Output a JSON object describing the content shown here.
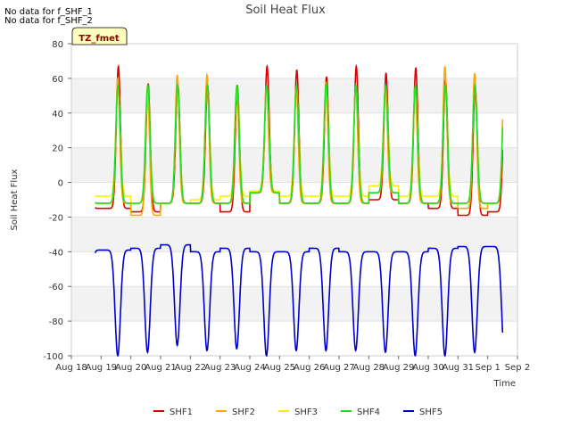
{
  "notes": [
    "No data for f_SHF_1",
    "No data for f_SHF_2"
  ],
  "chart_data": {
    "type": "line",
    "title": "Soil Heat Flux",
    "xlabel": "Time",
    "ylabel": "Soil Heat Flux",
    "annotation": "TZ_fmet",
    "xlim": [
      "Aug 18",
      "Sep 2"
    ],
    "ylim": [
      -100,
      80
    ],
    "x_ticks": [
      "Aug 18",
      "Aug 19",
      "Aug 20",
      "Aug 21",
      "Aug 22",
      "Aug 23",
      "Aug 24",
      "Aug 25",
      "Aug 26",
      "Aug 27",
      "Aug 28",
      "Aug 29",
      "Aug 30",
      "Aug 31",
      "Sep 1",
      "Sep 2"
    ],
    "y_ticks": [
      -100,
      -80,
      -60,
      -40,
      -20,
      0,
      20,
      40,
      60,
      80
    ],
    "grid": "horizontal bands",
    "legend_position": "bottom",
    "x_range_days": [
      18.8,
      32.5
    ],
    "daily_peaks": {
      "SHF1": [
        67,
        57,
        56,
        56,
        56,
        67,
        65,
        61,
        67,
        63,
        66,
        59,
        55,
        52
      ],
      "SHF2": [
        60,
        55,
        62,
        62,
        55,
        56,
        55,
        58,
        55,
        55,
        55,
        67,
        63,
        62
      ],
      "SHF3": [
        55,
        52,
        53,
        55,
        55,
        55,
        55,
        56,
        55,
        55,
        55,
        55,
        55,
        55
      ],
      "SHF4": [
        56,
        56,
        56,
        56,
        56,
        56,
        56,
        57,
        56,
        56,
        56,
        56,
        56,
        56
      ],
      "SHF5": [
        -100,
        -98,
        -94,
        -97,
        -96,
        -100,
        -97,
        -97,
        -97,
        -98,
        -100,
        -100,
        -98,
        -99
      ]
    },
    "daily_troughs": {
      "SHF1": [
        -15,
        -17,
        -12,
        -12,
        -17,
        -6,
        -12,
        -12,
        -12,
        -10,
        -12,
        -15,
        -19,
        -17
      ],
      "SHF2": [
        -12,
        -19,
        -12,
        -12,
        -12,
        -6,
        -12,
        -12,
        -12,
        -6,
        -12,
        -12,
        -15,
        -12
      ],
      "SHF3": [
        -8,
        -12,
        -12,
        -10,
        -8,
        -5,
        -8,
        -8,
        -8,
        -2,
        -8,
        -8,
        -12,
        -12
      ],
      "SHF4": [
        -12,
        -12,
        -12,
        -12,
        -12,
        -6,
        -12,
        -12,
        -12,
        -6,
        -12,
        -12,
        -12,
        -12
      ],
      "SHF5": [
        -39,
        -38,
        -36,
        -40,
        -38,
        -40,
        -40,
        -38,
        -40,
        -40,
        -40,
        -38,
        -37,
        -37
      ]
    },
    "series": [
      {
        "name": "SHF1",
        "color": "#dd0000"
      },
      {
        "name": "SHF2",
        "color": "#ffa500"
      },
      {
        "name": "SHF3",
        "color": "#ffee00"
      },
      {
        "name": "SHF4",
        "color": "#22dd22"
      },
      {
        "name": "SHF5",
        "color": "#0000cc"
      }
    ]
  }
}
